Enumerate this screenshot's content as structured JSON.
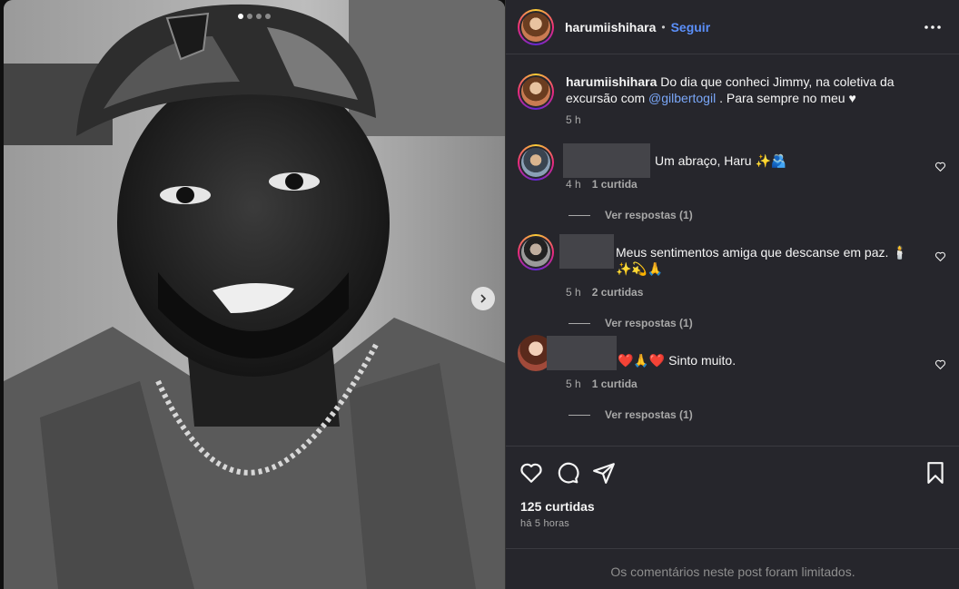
{
  "post": {
    "username": "harumiishihara",
    "separator": "•",
    "follow_label": "Seguir",
    "carousel": {
      "count": 4,
      "active": 0
    }
  },
  "caption": {
    "username": "harumiishihara",
    "text_before": " Do dia que conheci Jimmy, na coletiva da excursão com ",
    "mention": "@gilbertogil",
    "text_after": " . Para sempre no meu ♥",
    "time": "5 h"
  },
  "comments": [
    {
      "text": "Um abraço, Haru ✨🫂",
      "time": "4 h",
      "likes": "1 curtida",
      "replies": "Ver respostas (1)"
    },
    {
      "text": "Meus sentimentos amiga que descanse em paz. 🕯️✨💫🙏",
      "time": "5 h",
      "likes": "2 curtidas",
      "replies": "Ver respostas (1)"
    },
    {
      "text": "❤️🙏❤️ Sinto muito.",
      "time": "5 h",
      "likes": "1 curtida",
      "replies": "Ver respostas (1)"
    }
  ],
  "footer": {
    "likes_count": "125 curtidas",
    "posted_ago": "há 5 horas",
    "comments_limited": "Os comentários neste post foram limitados."
  },
  "colors": {
    "accent": "#5b8ff9",
    "panel": "#26262c",
    "muted": "#a8a8a8"
  },
  "icons": [
    "more-options-icon",
    "heart-icon",
    "comment-icon",
    "share-icon",
    "bookmark-icon",
    "chevron-right-icon"
  ]
}
